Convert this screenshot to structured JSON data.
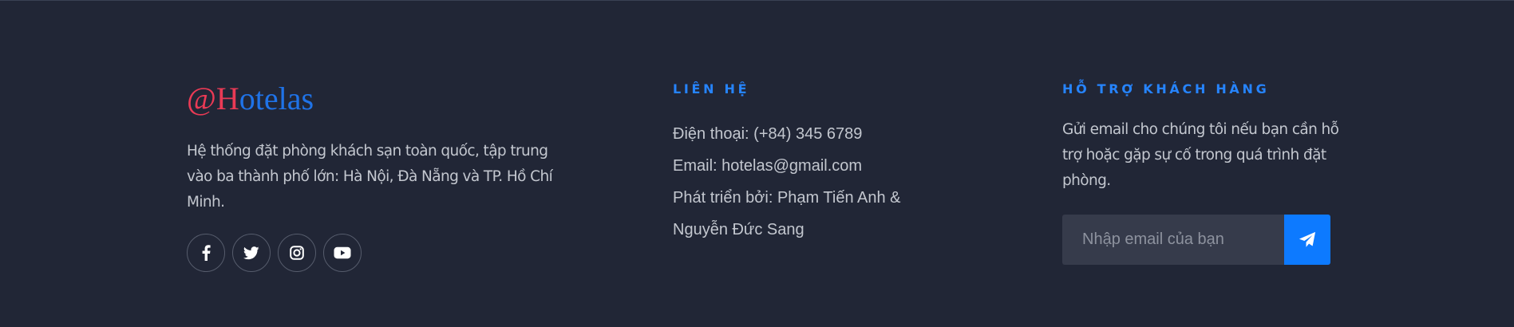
{
  "brand": {
    "logo_prefix": "@H",
    "logo_suffix": "otelas",
    "description": "Hệ thống đặt phòng khách sạn toàn quốc, tập trung vào ba thành phố lớn: Hà Nội, Đà Nẵng và TP. Hồ Chí Minh.",
    "socials": [
      {
        "icon": "facebook-icon"
      },
      {
        "icon": "twitter-icon"
      },
      {
        "icon": "instagram-icon"
      },
      {
        "icon": "youtube-icon"
      }
    ]
  },
  "contact": {
    "heading": "LIÊN HỆ",
    "phone": "Điện thoại: (+84) 345 6789",
    "email": "Email: hotelas@gmail.com",
    "developed_by_line1": "Phát triển bởi: Phạm Tiến Anh &",
    "developed_by_line2": "Nguyễn Đức Sang"
  },
  "support": {
    "heading": "HỖ TRỢ KHÁCH HÀNG",
    "description": "Gửi email cho chúng tôi nếu bạn cần hỗ trợ hoặc gặp sự cố trong quá trình đặt phòng.",
    "email_placeholder": "Nhập email của bạn",
    "send_icon": "paper-plane-icon"
  },
  "colors": {
    "background": "#212636",
    "accent": "#0d7aff",
    "logo_red": "#ea3a55",
    "logo_blue": "#1f73e8"
  }
}
